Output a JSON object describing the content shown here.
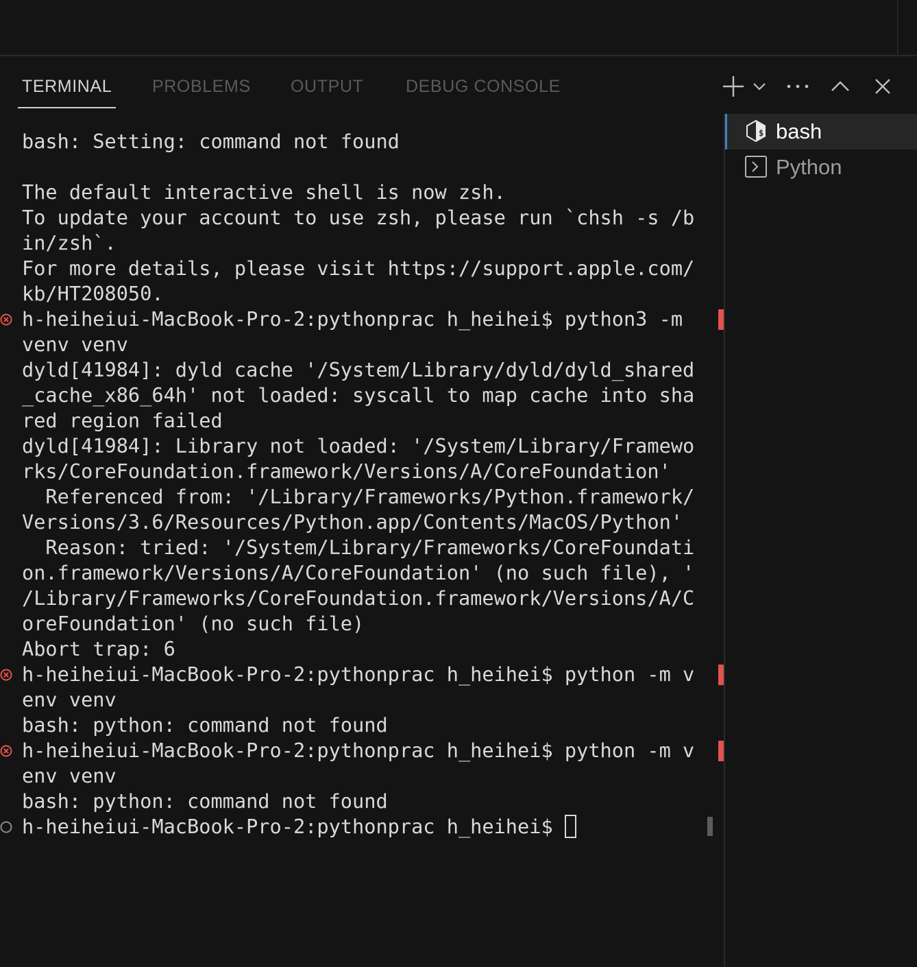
{
  "panel": {
    "tabs": [
      {
        "label": "TERMINAL",
        "active": true
      },
      {
        "label": "PROBLEMS",
        "active": false
      },
      {
        "label": "OUTPUT",
        "active": false
      },
      {
        "label": "DEBUG CONSOLE",
        "active": false
      }
    ],
    "actions": {
      "new_terminal": "plus-icon",
      "launch_profile": "chevron-down-icon",
      "more": "ellipsis-icon",
      "maximize": "chevron-up-icon",
      "close": "close-icon"
    }
  },
  "terminal": {
    "lines": [
      "bash: Setting: command not found",
      "",
      "The default interactive shell is now zsh.",
      "To update your account to use zsh, please run `chsh -s /b",
      "in/zsh`.",
      "For more details, please visit https://support.apple.com/",
      "kb/HT208050.",
      "h-heiheiui-MacBook-Pro-2:pythonprac h_heihei$ python3 -m",
      "venv venv",
      "dyld[41984]: dyld cache '/System/Library/dyld/dyld_shared",
      "_cache_x86_64h' not loaded: syscall to map cache into sha",
      "red region failed",
      "dyld[41984]: Library not loaded: '/System/Library/Framewo",
      "rks/CoreFoundation.framework/Versions/A/CoreFoundation'",
      "  Referenced from: '/Library/Frameworks/Python.framework/",
      "Versions/3.6/Resources/Python.app/Contents/MacOS/Python'",
      "  Reason: tried: '/System/Library/Frameworks/CoreFoundati",
      "on.framework/Versions/A/CoreFoundation' (no such file), '",
      "/Library/Frameworks/CoreFoundation.framework/Versions/A/C",
      "oreFoundation' (no such file)",
      "Abort trap: 6",
      "h-heiheiui-MacBook-Pro-2:pythonprac h_heihei$ python -m v",
      "env venv",
      "bash: python: command not found",
      "h-heiheiui-MacBook-Pro-2:pythonprac h_heihei$ python -m v",
      "env venv",
      "bash: python: command not found",
      "h-heiheiui-MacBook-Pro-2:pythonprac h_heihei$ "
    ],
    "decorations": [
      {
        "line": 7,
        "status": "error"
      },
      {
        "line": 21,
        "status": "error"
      },
      {
        "line": 24,
        "status": "error"
      },
      {
        "line": 27,
        "status": "default"
      }
    ],
    "cursor_line": 27
  },
  "terminal_list": [
    {
      "name": "bash",
      "icon": "bash-shell-icon",
      "active": true
    },
    {
      "name": "Python",
      "icon": "terminal-prompt-icon",
      "active": false
    }
  ],
  "colors": {
    "background": "#141414",
    "error": "#e0534f",
    "active_tab": "#d4d4d4",
    "inactive_tab": "#5a5a5a",
    "focus_border": "#3c83c6"
  }
}
